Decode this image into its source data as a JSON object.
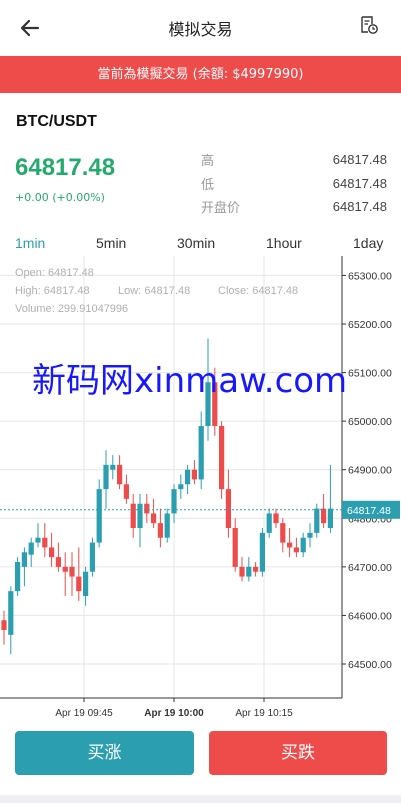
{
  "header": {
    "title": "模拟交易",
    "back_icon": "arrow-left-icon",
    "history_icon": "history-icon"
  },
  "banner": {
    "text": "當前為模擬交易 (余額: $4997990)"
  },
  "market": {
    "pair": "BTC/USDT",
    "price": "64817.48",
    "change": "+0.00 (+0.00%)",
    "stats": [
      {
        "label": "高",
        "value": "64817.48"
      },
      {
        "label": "低",
        "value": "64817.48"
      },
      {
        "label": "开盘价",
        "value": "64817.48"
      }
    ]
  },
  "timeframes": [
    {
      "label": "1min",
      "active": true
    },
    {
      "label": "5min",
      "active": false
    },
    {
      "label": "30min",
      "active": false
    },
    {
      "label": "1hour",
      "active": false
    },
    {
      "label": "1day",
      "active": false
    }
  ],
  "ohlc": {
    "open_label": "Open:",
    "open": "64817.48",
    "high_label": "High:",
    "high": "64817.48",
    "low_label": "Low:",
    "low": "64817.48",
    "close_label": "Close:",
    "close": "64817.48",
    "volume_label": "Volume:",
    "volume": "299.91047996"
  },
  "watermark": "新码网xinmaw.com",
  "colors": {
    "up": "#2b9fb0",
    "down": "#ee4b4b",
    "accent": "#2b9fb0",
    "price_green": "#26a96c"
  },
  "chart_data": {
    "type": "candlestick",
    "y_ticks": [
      "65300.00",
      "65200.00",
      "65100.00",
      "65000.00",
      "64900.00",
      "64800.00",
      "64700.00",
      "64600.00",
      "64500.00"
    ],
    "x_ticks": [
      "Apr 19 09:45",
      "Apr 19 10:00",
      "Apr 19 10:15"
    ],
    "current_price_label": "64817.48",
    "ylim": [
      64430,
      65340
    ],
    "candles": [
      {
        "o": 64590,
        "h": 64610,
        "l": 64540,
        "c": 64570
      },
      {
        "o": 64560,
        "h": 64660,
        "l": 64520,
        "c": 64650
      },
      {
        "o": 64650,
        "h": 64720,
        "l": 64640,
        "c": 64710
      },
      {
        "o": 64700,
        "h": 64740,
        "l": 64660,
        "c": 64730
      },
      {
        "o": 64725,
        "h": 64760,
        "l": 64700,
        "c": 64750
      },
      {
        "o": 64750,
        "h": 64790,
        "l": 64740,
        "c": 64760
      },
      {
        "o": 64760,
        "h": 64790,
        "l": 64720,
        "c": 64740
      },
      {
        "o": 64740,
        "h": 64770,
        "l": 64700,
        "c": 64720
      },
      {
        "o": 64720,
        "h": 64750,
        "l": 64690,
        "c": 64700
      },
      {
        "o": 64700,
        "h": 64730,
        "l": 64640,
        "c": 64690
      },
      {
        "o": 64700,
        "h": 64730,
        "l": 64640,
        "c": 64680
      },
      {
        "o": 64680,
        "h": 64740,
        "l": 64630,
        "c": 64650
      },
      {
        "o": 64640,
        "h": 64700,
        "l": 64620,
        "c": 64690
      },
      {
        "o": 64690,
        "h": 64760,
        "l": 64680,
        "c": 64750
      },
      {
        "o": 64750,
        "h": 64880,
        "l": 64740,
        "c": 64860
      },
      {
        "o": 64860,
        "h": 64940,
        "l": 64820,
        "c": 64910
      },
      {
        "o": 64900,
        "h": 64930,
        "l": 64880,
        "c": 64910
      },
      {
        "o": 64910,
        "h": 64930,
        "l": 64860,
        "c": 64870
      },
      {
        "o": 64870,
        "h": 64890,
        "l": 64830,
        "c": 64840
      },
      {
        "o": 64830,
        "h": 64850,
        "l": 64760,
        "c": 64780
      },
      {
        "o": 64780,
        "h": 64850,
        "l": 64740,
        "c": 64830
      },
      {
        "o": 64830,
        "h": 64850,
        "l": 64790,
        "c": 64810
      },
      {
        "o": 64810,
        "h": 64840,
        "l": 64780,
        "c": 64790
      },
      {
        "o": 64790,
        "h": 64820,
        "l": 64740,
        "c": 64760
      },
      {
        "o": 64760,
        "h": 64820,
        "l": 64750,
        "c": 64810
      },
      {
        "o": 64810,
        "h": 64870,
        "l": 64790,
        "c": 64860
      },
      {
        "o": 64860,
        "h": 64890,
        "l": 64840,
        "c": 64870
      },
      {
        "o": 64870,
        "h": 64910,
        "l": 64850,
        "c": 64900
      },
      {
        "o": 64900,
        "h": 64920,
        "l": 64870,
        "c": 64880
      },
      {
        "o": 64880,
        "h": 65020,
        "l": 64860,
        "c": 64990
      },
      {
        "o": 64990,
        "h": 65170,
        "l": 64960,
        "c": 65080
      },
      {
        "o": 65080,
        "h": 65110,
        "l": 64970,
        "c": 64990
      },
      {
        "o": 64990,
        "h": 65000,
        "l": 64840,
        "c": 64860
      },
      {
        "o": 64860,
        "h": 64900,
        "l": 64760,
        "c": 64780
      },
      {
        "o": 64780,
        "h": 64800,
        "l": 64690,
        "c": 64700
      },
      {
        "o": 64700,
        "h": 64720,
        "l": 64670,
        "c": 64680
      },
      {
        "o": 64680,
        "h": 64720,
        "l": 64670,
        "c": 64700
      },
      {
        "o": 64700,
        "h": 64710,
        "l": 64680,
        "c": 64690
      },
      {
        "o": 64690,
        "h": 64780,
        "l": 64680,
        "c": 64770
      },
      {
        "o": 64770,
        "h": 64820,
        "l": 64760,
        "c": 64810
      },
      {
        "o": 64810,
        "h": 64820,
        "l": 64780,
        "c": 64790
      },
      {
        "o": 64790,
        "h": 64800,
        "l": 64730,
        "c": 64750
      },
      {
        "o": 64750,
        "h": 64780,
        "l": 64720,
        "c": 64740
      },
      {
        "o": 64740,
        "h": 64760,
        "l": 64720,
        "c": 64730
      },
      {
        "o": 64730,
        "h": 64770,
        "l": 64720,
        "c": 64760
      },
      {
        "o": 64760,
        "h": 64790,
        "l": 64740,
        "c": 64770
      },
      {
        "o": 64770,
        "h": 64830,
        "l": 64760,
        "c": 64820
      },
      {
        "o": 64820,
        "h": 64850,
        "l": 64780,
        "c": 64790
      },
      {
        "o": 64780,
        "h": 64910,
        "l": 64770,
        "c": 64820
      }
    ]
  },
  "buttons": {
    "buy": "买涨",
    "sell": "买跌"
  }
}
